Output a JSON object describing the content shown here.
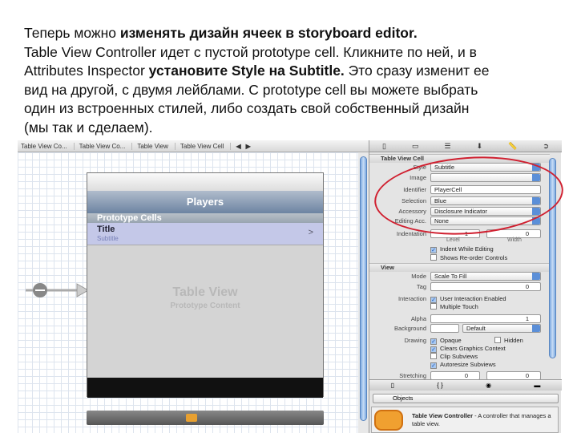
{
  "text": {
    "l1a": "Теперь можно ",
    "l1b": "изменять дизайн ячеек в storyboard editor.",
    "l2": "Table View Controller идет с пустой prototype cell. Кликните по ней, и в",
    "l3a": "Attributes Inspector ",
    "l3b": "установите Style на Subtitle.",
    "l3c": " Это сразу изменит ее",
    "l4": "вид на другой, с двумя лейблами. С prototype cell вы можете выбрать",
    "l5": "один из встроенных стилей, либо создать свой собственный дизайн",
    "l6": "(мы так и сделаем)."
  },
  "jumpbar": [
    "Table View Co...",
    "Table View Co...",
    "Table View",
    "Table View Cell"
  ],
  "phone": {
    "nav_title": "Players",
    "section": "Prototype Cells",
    "cell_title": "Title",
    "cell_subtitle": "Subtitle",
    "chevron": ">",
    "placeholder_title": "Table View",
    "placeholder_sub": "Prototype Content"
  },
  "inspector": {
    "cell_header": "Table View Cell",
    "style_label": "Style",
    "style": "Subtitle",
    "image_label": "Image",
    "image": "",
    "identifier_label": "Identifier",
    "identifier": "PlayerCell",
    "selection_label": "Selection",
    "selection": "Blue",
    "accessory_label": "Accessory",
    "accessory": "Disclosure Indicator",
    "editing_label": "Editing Acc.",
    "editing": "None",
    "indentation_label": "Indentation",
    "level": "1",
    "width": "0",
    "level_label": "Level",
    "width_label": "Width",
    "indent_while_editing": "Indent While Editing",
    "shows_reorder": "Shows Re-order Controls",
    "view_header": "View",
    "mode_label": "Mode",
    "mode": "Scale To Fill",
    "tag_label": "Tag",
    "tag": "0",
    "interaction_label": "Interaction",
    "user_interaction": "User Interaction Enabled",
    "multiple_touch": "Multiple Touch",
    "alpha_label": "Alpha",
    "alpha": "1",
    "background_label": "Background",
    "background": "Default",
    "drawing_label": "Drawing",
    "opaque": "Opaque",
    "hidden": "Hidden",
    "clears": "Clears Graphics Context",
    "clip": "Clip Subviews",
    "autoresize": "Autoresize Subviews",
    "stretching_label": "Stretching",
    "stretch1": "0",
    "stretch2": "0"
  },
  "library": {
    "objects": "Objects",
    "item_title": "Table View Controller",
    "item_desc": " - A controller that manages a table view."
  },
  "colors": {
    "annotation": "#d02030",
    "accent": "#5b8fd8"
  }
}
